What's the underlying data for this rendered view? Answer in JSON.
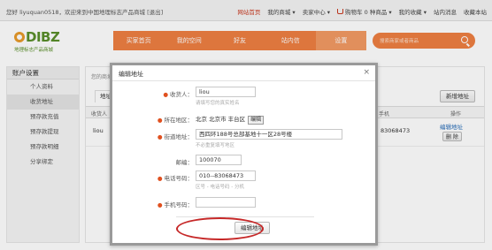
{
  "topbar": {
    "welcome": "您好 liyuquan0518，欢迎来到中国地理标志产品商城 [退出]",
    "links": [
      {
        "label": "网站首页",
        "highlight": true
      },
      {
        "label": "我的商城 ▾",
        "highlight": false
      },
      {
        "label": "卖家中心 ▾",
        "highlight": false
      },
      {
        "label": "购物车 0 种商品 ▾",
        "highlight": false
      },
      {
        "label": "我的收藏 ▾",
        "highlight": false
      },
      {
        "label": "站内消息",
        "highlight": false
      },
      {
        "label": "收藏本站",
        "highlight": false
      }
    ]
  },
  "logo": {
    "text": "DIBZ",
    "subtitle": "地理标志产品商城"
  },
  "nav": [
    {
      "label": "买家首页",
      "active": false
    },
    {
      "label": "我的空间",
      "active": false
    },
    {
      "label": "好友",
      "active": false
    },
    {
      "label": "站内信",
      "active": false
    },
    {
      "label": "设置",
      "active": true
    }
  ],
  "search": {
    "placeholder": "搜索商家或者商品"
  },
  "sidebar": {
    "title": "账户设置",
    "items": [
      {
        "label": "个人资料",
        "active": false
      },
      {
        "label": "收货地址",
        "active": true
      },
      {
        "label": "预存款充值",
        "active": false
      },
      {
        "label": "预存款提现",
        "active": false
      },
      {
        "label": "预存款明细",
        "active": false
      },
      {
        "label": "分享绑定",
        "active": false
      }
    ]
  },
  "main": {
    "breadcrumb": "您的商城",
    "tab": "地址列",
    "new_address_label": "新增地址",
    "columns": {
      "receiver": "收货人",
      "phone": "手机",
      "action": "操作"
    },
    "row": {
      "receiver": "liou",
      "phone": "83068473",
      "edit": "编辑地址",
      "delete": "删 除"
    }
  },
  "dialog": {
    "title": "编辑地址",
    "close": "×",
    "fields": {
      "receiver": {
        "label": "收货人：",
        "required": true,
        "value": "liou",
        "hint": "请填写您的真实姓名"
      },
      "region": {
        "label": "所在地区：",
        "required": true,
        "value": "北京 北京市 丰台区",
        "edit_label": "编辑"
      },
      "street": {
        "label": "街道地址：",
        "required": true,
        "value": "西四环188号总部基地十一区28号楼",
        "hint": "不必重复填写地区"
      },
      "zip": {
        "label": "邮编：",
        "required": false,
        "value": "100070"
      },
      "phone": {
        "label": "电话号码：",
        "required": true,
        "value": "010--83068473",
        "hint": "区号 - 电话号码 - 分机"
      },
      "mobile": {
        "label": "手机号码：",
        "required": true,
        "value": ""
      }
    },
    "submit_label": "编辑地址"
  },
  "colors": {
    "nav_orange": "#ee7f42",
    "annotation_red": "#c62828",
    "logo_green": "#5a8f2a"
  }
}
